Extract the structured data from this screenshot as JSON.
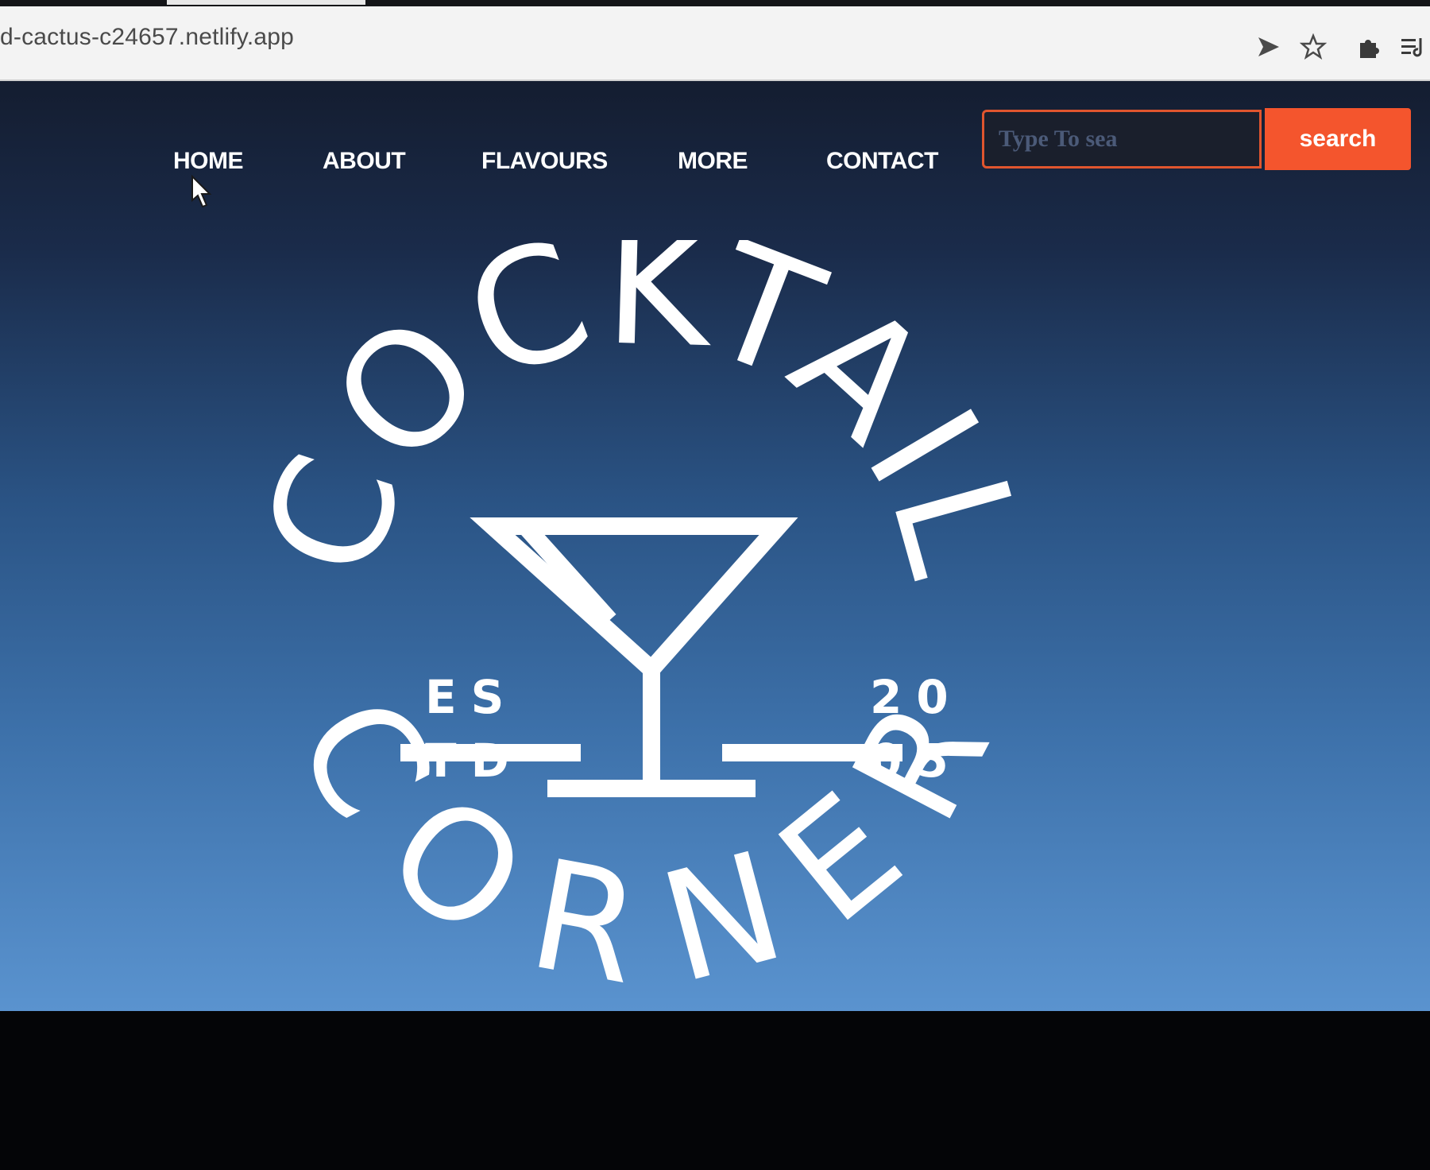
{
  "browser": {
    "url": "d-cactus-c24657.netlify.app",
    "icons": [
      "send-icon",
      "star-icon",
      "puzzle-icon",
      "media-queue-icon"
    ]
  },
  "nav": {
    "items": [
      {
        "label": "HOME"
      },
      {
        "label": "ABOUT"
      },
      {
        "label": "FLAVOURS"
      },
      {
        "label": "MORE"
      },
      {
        "label": "CONTACT"
      }
    ]
  },
  "search": {
    "placeholder": "Type To sea",
    "value": "",
    "button_label": "search"
  },
  "logo": {
    "top_text": "COCKTAIL",
    "bottom_text": "CORNER",
    "est_left_top": "ES",
    "est_left_bottom": "TD",
    "year_right_top": "20",
    "year_right_bottom": "05"
  },
  "colors": {
    "accent": "#f4552d",
    "hero_top": "#141d30",
    "hero_bottom": "#5a93cf",
    "logo": "#ffffff"
  }
}
